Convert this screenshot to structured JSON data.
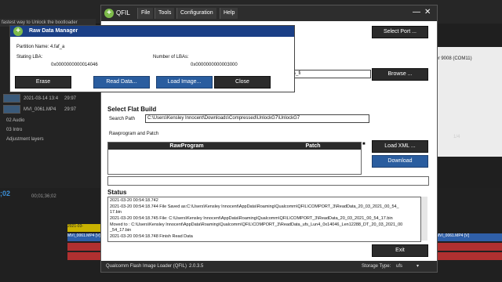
{
  "background": {
    "tab_title": "fastest way to Unlock the bootloader",
    "panel_rows": [
      {
        "a": "2021-03-14 13:4",
        "b": "29:97"
      },
      {
        "a": "MVI_0061.MP4",
        "b": "29:97"
      },
      {
        "a": "02 Audio",
        "b": ""
      },
      {
        "a": "03 Intro",
        "b": ""
      },
      {
        "a": "Adjustment layers",
        "b": ""
      }
    ],
    "right_panel_text": "der 9008 (COM11)",
    "right_small_1": "1/4",
    "timeline_time": ";02",
    "timeline_ruler": "00;01;36;02",
    "clip_labels": [
      "2021-03-",
      "MVI_0061.MP4 [V]",
      "MVI_0061.MP4 [V]"
    ]
  },
  "qfil": {
    "app_name": "QFIL",
    "menu": [
      "File",
      "Tools",
      "Configuration",
      "Help"
    ],
    "select_port": "Select Port ...",
    "browse": "Browse ...",
    "path_partial": "nlockG7\\UnlockG7\\prog_ufs_fi",
    "select_flat_build": "Select Flat Build",
    "search_path_label": "Search Path",
    "search_path_value": "C:\\Users\\Kensley Innocent\\Downloads\\Compressed\\UnlockG7\\UnlockG7",
    "rawprogram_patch_label": "Rawprogram and Patch",
    "col_rawprogram": "RawProgram",
    "col_patch": "Patch",
    "load_xml": "Load XML ...",
    "download": "Download",
    "status_heading": "Status",
    "status_lines": [
      "2021-03-20 00:54:18.742",
      "2021-03-20 00:54:18.744   File Saved as:C:\\Users\\Kensley Innocent\\AppData\\Roaming\\Qualcomm\\QFIL\\COMPORT_3\\ReadData_20_03_2021_00_54_",
      "17.bin",
      "2021-03-20 00:54:18.745   File: C:\\Users\\Kensley Innocent\\AppData\\Roaming\\Qualcomm\\QFIL\\COMPORT_3\\ReadData_20_03_2021_00_54_17.bin",
      "Moved to : C:\\Users\\Kensley Innocent\\AppData\\Roaming\\Qualcomm\\QFIL\\COMPORT_3\\ReadData_ufs_Lun4_0x14046_Len12288_DT_20_03_2021_00",
      "_54_17.bin",
      "2021-03-20 00:54:18.748   Finish Read Data"
    ],
    "exit": "Exit",
    "footer_name": "Qualcomm Flash Image Loader (QFIL)",
    "footer_version": "2.0.3.5",
    "storage_type_label": "Storage Type:",
    "storage_type_value": "ufs"
  },
  "rdm": {
    "title": "Raw Data Manager",
    "partition_label": "Partition Name: 4.faf_a",
    "starting_lba_label": "Stating LBA:",
    "starting_lba_value": "0x0000000000014046",
    "num_lbas_label": "Number of LBAs:",
    "num_lbas_value": "0x0000000000003000",
    "erase": "Erase",
    "read_data": "Read Data...",
    "load_image": "Load Image...",
    "close": "Close"
  }
}
